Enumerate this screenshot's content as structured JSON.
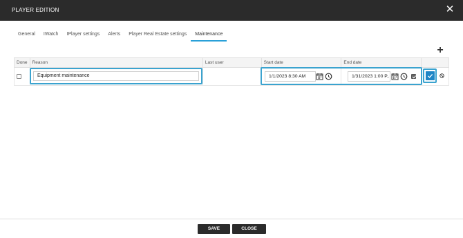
{
  "window": {
    "title": "PLAYER EDITION",
    "close_glyph": "✕"
  },
  "tabs": [
    {
      "label": "General"
    },
    {
      "label": "IWatch"
    },
    {
      "label": "IPlayer settings"
    },
    {
      "label": "Alerts"
    },
    {
      "label": "Player Real Estate settings"
    },
    {
      "label": "Maintenance",
      "active": true
    }
  ],
  "toolbar": {
    "add_glyph": "+"
  },
  "table": {
    "columns": [
      "Done",
      "Reason",
      "Last user",
      "Start date",
      "End date",
      ""
    ],
    "row": {
      "done": false,
      "reason": "Equipment maintenance",
      "last_user": "",
      "start_date": "1/1/2023 8:30 AM",
      "end_date": "1/31/2023 1:00 P...",
      "end_date_checked": true
    }
  },
  "footer": {
    "save_label": "SAVE",
    "close_label": "CLOSE"
  },
  "colors": {
    "accent": "#29a0d8",
    "highlight": "#3ba3cf",
    "save_button": "#1f86c6",
    "titlebar": "#2b2b2b"
  }
}
